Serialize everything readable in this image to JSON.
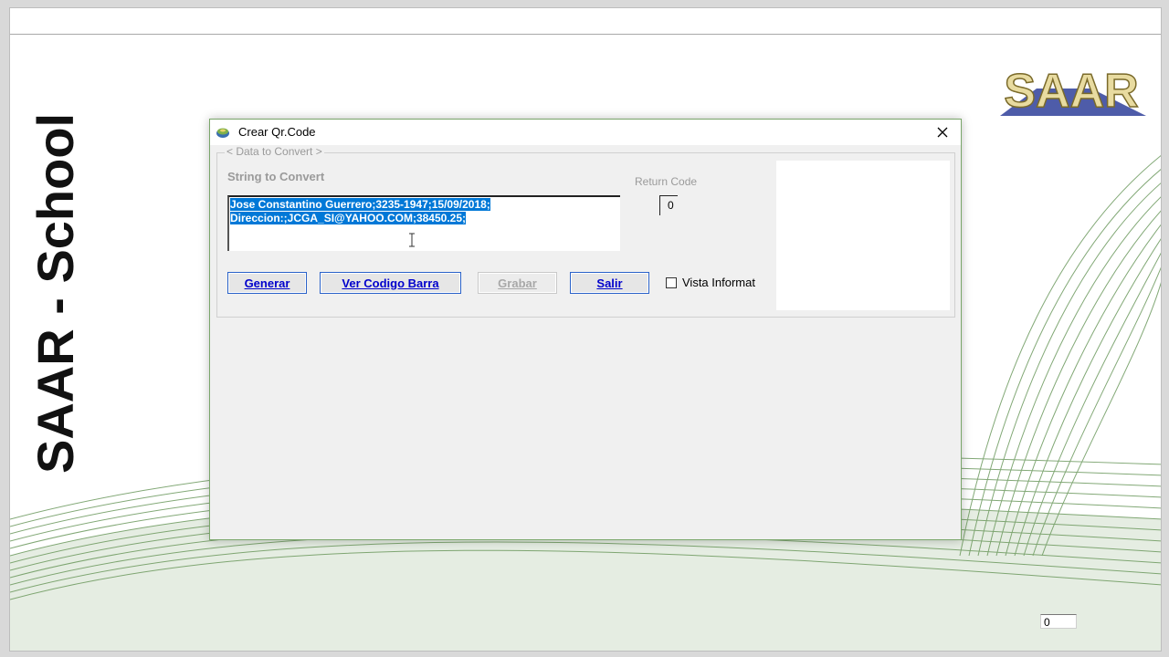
{
  "window": {
    "side_text": "SAAR - School",
    "logo_text": "SAAR",
    "corner_value": "0"
  },
  "dialog": {
    "title": "Crear Qr.Code",
    "group_label": "< Data to Convert >",
    "string_label": "String to Convert",
    "string_lines": [
      "Jose Constantino Guerrero;3235-1947;15/09/2018;",
      "Direccion:;JCGA_SI@YAHOO.COM;38450.25;"
    ],
    "return_code_label": "Return Code",
    "return_code_value": "0",
    "buttons": {
      "generar": "Generar",
      "ver_codigo_barra": "Ver Codigo Barra",
      "grabar": "Grabar",
      "salir": "Salir"
    },
    "checkbox_label": "Vista Informat"
  },
  "colors": {
    "selection": "#0078d7",
    "button_text": "#0000cc",
    "wave_green": "#6d9a5f"
  }
}
